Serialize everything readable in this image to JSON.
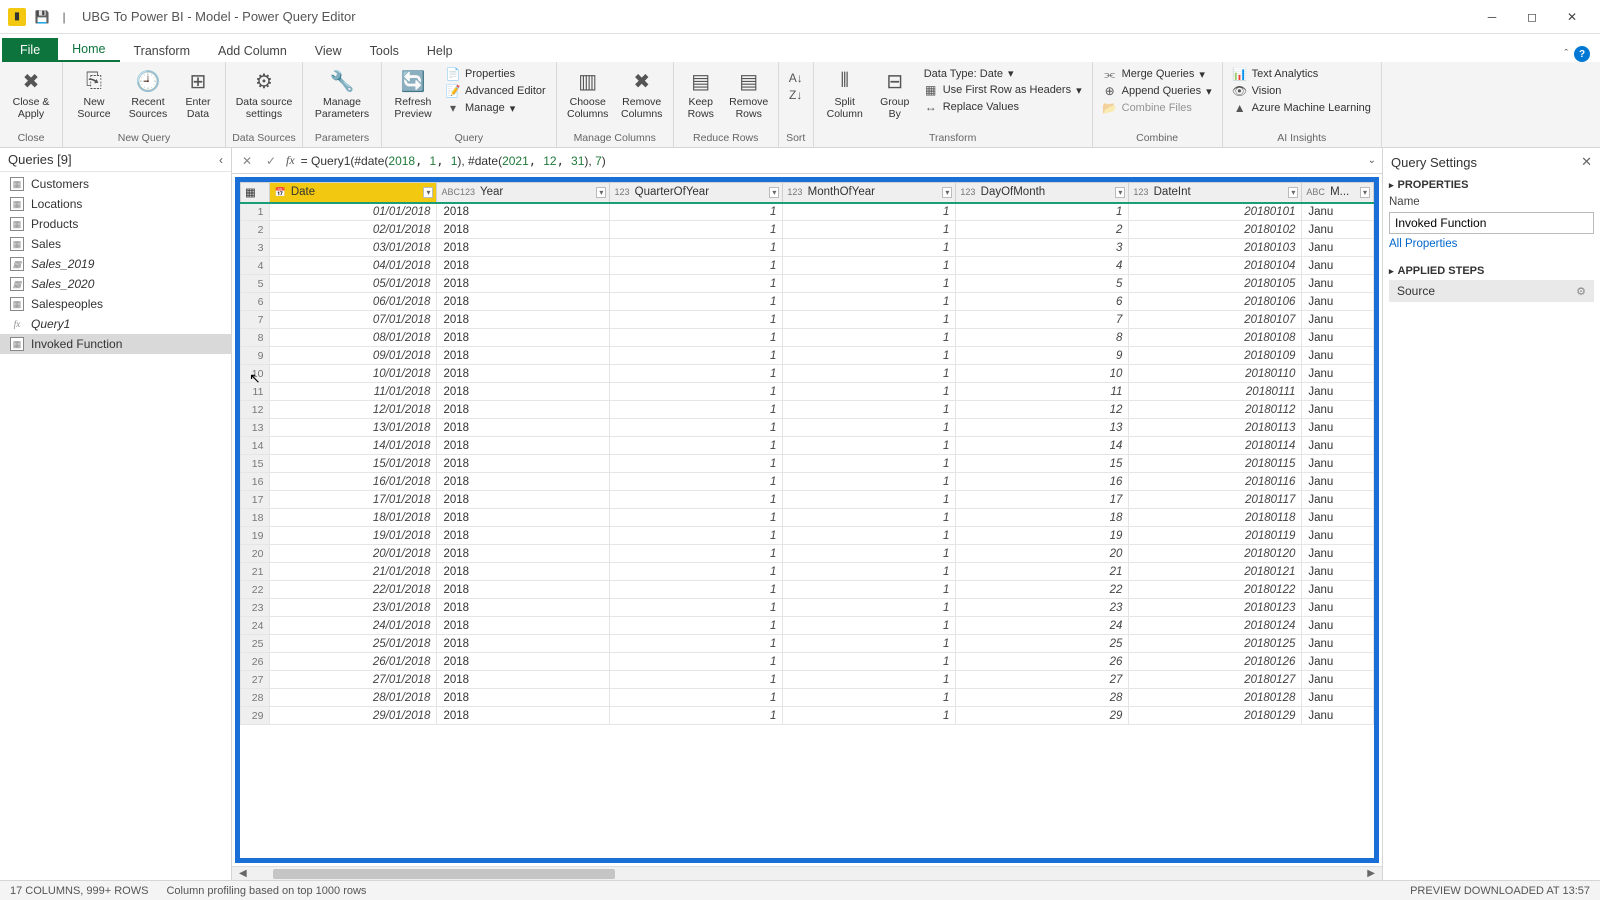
{
  "window": {
    "title": "UBG To Power BI - Model - Power Query Editor"
  },
  "tabs": {
    "file": "File",
    "home": "Home",
    "transform": "Transform",
    "addcolumn": "Add Column",
    "view": "View",
    "tools": "Tools",
    "help": "Help"
  },
  "ribbon": {
    "close_apply": "Close &\nApply",
    "close_grp": "Close",
    "new_source": "New\nSource",
    "recent_sources": "Recent\nSources",
    "enter_data": "Enter\nData",
    "newquery_grp": "New Query",
    "data_source": "Data source\nsettings",
    "datasources_grp": "Data Sources",
    "manage_params": "Manage\nParameters",
    "params_grp": "Parameters",
    "refresh": "Refresh\nPreview",
    "properties": "Properties",
    "adv_editor": "Advanced Editor",
    "manage": "Manage",
    "query_grp": "Query",
    "choose_cols": "Choose\nColumns",
    "remove_cols": "Remove\nColumns",
    "managecols_grp": "Manage Columns",
    "keep_rows": "Keep\nRows",
    "remove_rows": "Remove\nRows",
    "reducerows_grp": "Reduce Rows",
    "sort_grp": "Sort",
    "split_col": "Split\nColumn",
    "group_by": "Group\nBy",
    "data_type": "Data Type: Date",
    "first_row": "Use First Row as Headers",
    "replace_vals": "Replace Values",
    "transform_grp": "Transform",
    "merge_q": "Merge Queries",
    "append_q": "Append Queries",
    "combine_files": "Combine Files",
    "combine_grp": "Combine",
    "text_analytics": "Text Analytics",
    "vision": "Vision",
    "azure_ml": "Azure Machine Learning",
    "ai_grp": "AI Insights"
  },
  "queries": {
    "header": "Queries [9]",
    "items": [
      {
        "name": "Customers",
        "type": "table"
      },
      {
        "name": "Locations",
        "type": "table"
      },
      {
        "name": "Products",
        "type": "table"
      },
      {
        "name": "Sales",
        "type": "table"
      },
      {
        "name": "Sales_2019",
        "type": "table",
        "italic": true
      },
      {
        "name": "Sales_2020",
        "type": "table",
        "italic": true
      },
      {
        "name": "Salespeoples",
        "type": "table"
      },
      {
        "name": "Query1",
        "type": "fx",
        "italic": true
      },
      {
        "name": "Invoked Function",
        "type": "table",
        "selected": true
      }
    ]
  },
  "formula": {
    "prefix": "= Query1(#date(",
    "a1": "2018",
    "a2": "1",
    "a3": "1",
    "mid": "), #date(",
    "b1": "2021",
    "b2": "12",
    "b3": "31",
    "end": "), ",
    "last": "7",
    "close": ")"
  },
  "columns": [
    "Date",
    "Year",
    "QuarterOfYear",
    "MonthOfYear",
    "DayOfMonth",
    "DateInt",
    "M..."
  ],
  "col_types": [
    "📅",
    "ABC123",
    "123",
    "123",
    "123",
    "123",
    "ABC"
  ],
  "rows": [
    {
      "n": 1,
      "date": "01/01/2018",
      "year": "2018",
      "q": "1",
      "m": "1",
      "d": "1",
      "di": "20180101",
      "mn": "Janu"
    },
    {
      "n": 2,
      "date": "02/01/2018",
      "year": "2018",
      "q": "1",
      "m": "1",
      "d": "2",
      "di": "20180102",
      "mn": "Janu"
    },
    {
      "n": 3,
      "date": "03/01/2018",
      "year": "2018",
      "q": "1",
      "m": "1",
      "d": "3",
      "di": "20180103",
      "mn": "Janu"
    },
    {
      "n": 4,
      "date": "04/01/2018",
      "year": "2018",
      "q": "1",
      "m": "1",
      "d": "4",
      "di": "20180104",
      "mn": "Janu"
    },
    {
      "n": 5,
      "date": "05/01/2018",
      "year": "2018",
      "q": "1",
      "m": "1",
      "d": "5",
      "di": "20180105",
      "mn": "Janu"
    },
    {
      "n": 6,
      "date": "06/01/2018",
      "year": "2018",
      "q": "1",
      "m": "1",
      "d": "6",
      "di": "20180106",
      "mn": "Janu"
    },
    {
      "n": 7,
      "date": "07/01/2018",
      "year": "2018",
      "q": "1",
      "m": "1",
      "d": "7",
      "di": "20180107",
      "mn": "Janu"
    },
    {
      "n": 8,
      "date": "08/01/2018",
      "year": "2018",
      "q": "1",
      "m": "1",
      "d": "8",
      "di": "20180108",
      "mn": "Janu"
    },
    {
      "n": 9,
      "date": "09/01/2018",
      "year": "2018",
      "q": "1",
      "m": "1",
      "d": "9",
      "di": "20180109",
      "mn": "Janu"
    },
    {
      "n": 10,
      "date": "10/01/2018",
      "year": "2018",
      "q": "1",
      "m": "1",
      "d": "10",
      "di": "20180110",
      "mn": "Janu"
    },
    {
      "n": 11,
      "date": "11/01/2018",
      "year": "2018",
      "q": "1",
      "m": "1",
      "d": "11",
      "di": "20180111",
      "mn": "Janu"
    },
    {
      "n": 12,
      "date": "12/01/2018",
      "year": "2018",
      "q": "1",
      "m": "1",
      "d": "12",
      "di": "20180112",
      "mn": "Janu"
    },
    {
      "n": 13,
      "date": "13/01/2018",
      "year": "2018",
      "q": "1",
      "m": "1",
      "d": "13",
      "di": "20180113",
      "mn": "Janu"
    },
    {
      "n": 14,
      "date": "14/01/2018",
      "year": "2018",
      "q": "1",
      "m": "1",
      "d": "14",
      "di": "20180114",
      "mn": "Janu"
    },
    {
      "n": 15,
      "date": "15/01/2018",
      "year": "2018",
      "q": "1",
      "m": "1",
      "d": "15",
      "di": "20180115",
      "mn": "Janu"
    },
    {
      "n": 16,
      "date": "16/01/2018",
      "year": "2018",
      "q": "1",
      "m": "1",
      "d": "16",
      "di": "20180116",
      "mn": "Janu"
    },
    {
      "n": 17,
      "date": "17/01/2018",
      "year": "2018",
      "q": "1",
      "m": "1",
      "d": "17",
      "di": "20180117",
      "mn": "Janu"
    },
    {
      "n": 18,
      "date": "18/01/2018",
      "year": "2018",
      "q": "1",
      "m": "1",
      "d": "18",
      "di": "20180118",
      "mn": "Janu"
    },
    {
      "n": 19,
      "date": "19/01/2018",
      "year": "2018",
      "q": "1",
      "m": "1",
      "d": "19",
      "di": "20180119",
      "mn": "Janu"
    },
    {
      "n": 20,
      "date": "20/01/2018",
      "year": "2018",
      "q": "1",
      "m": "1",
      "d": "20",
      "di": "20180120",
      "mn": "Janu"
    },
    {
      "n": 21,
      "date": "21/01/2018",
      "year": "2018",
      "q": "1",
      "m": "1",
      "d": "21",
      "di": "20180121",
      "mn": "Janu"
    },
    {
      "n": 22,
      "date": "22/01/2018",
      "year": "2018",
      "q": "1",
      "m": "1",
      "d": "22",
      "di": "20180122",
      "mn": "Janu"
    },
    {
      "n": 23,
      "date": "23/01/2018",
      "year": "2018",
      "q": "1",
      "m": "1",
      "d": "23",
      "di": "20180123",
      "mn": "Janu"
    },
    {
      "n": 24,
      "date": "24/01/2018",
      "year": "2018",
      "q": "1",
      "m": "1",
      "d": "24",
      "di": "20180124",
      "mn": "Janu"
    },
    {
      "n": 25,
      "date": "25/01/2018",
      "year": "2018",
      "q": "1",
      "m": "1",
      "d": "25",
      "di": "20180125",
      "mn": "Janu"
    },
    {
      "n": 26,
      "date": "26/01/2018",
      "year": "2018",
      "q": "1",
      "m": "1",
      "d": "26",
      "di": "20180126",
      "mn": "Janu"
    },
    {
      "n": 27,
      "date": "27/01/2018",
      "year": "2018",
      "q": "1",
      "m": "1",
      "d": "27",
      "di": "20180127",
      "mn": "Janu"
    },
    {
      "n": 28,
      "date": "28/01/2018",
      "year": "2018",
      "q": "1",
      "m": "1",
      "d": "28",
      "di": "20180128",
      "mn": "Janu"
    },
    {
      "n": 29,
      "date": "29/01/2018",
      "year": "2018",
      "q": "1",
      "m": "1",
      "d": "29",
      "di": "20180129",
      "mn": "Janu"
    }
  ],
  "settings": {
    "header": "Query Settings",
    "properties": "PROPERTIES",
    "name_lbl": "Name",
    "name_val": "Invoked Function",
    "all_props": "All Properties",
    "applied": "APPLIED STEPS",
    "step0": "Source"
  },
  "status": {
    "left1": "17 COLUMNS, 999+ ROWS",
    "left2": "Column profiling based on top 1000 rows",
    "right": "PREVIEW DOWNLOADED AT 13:57"
  }
}
